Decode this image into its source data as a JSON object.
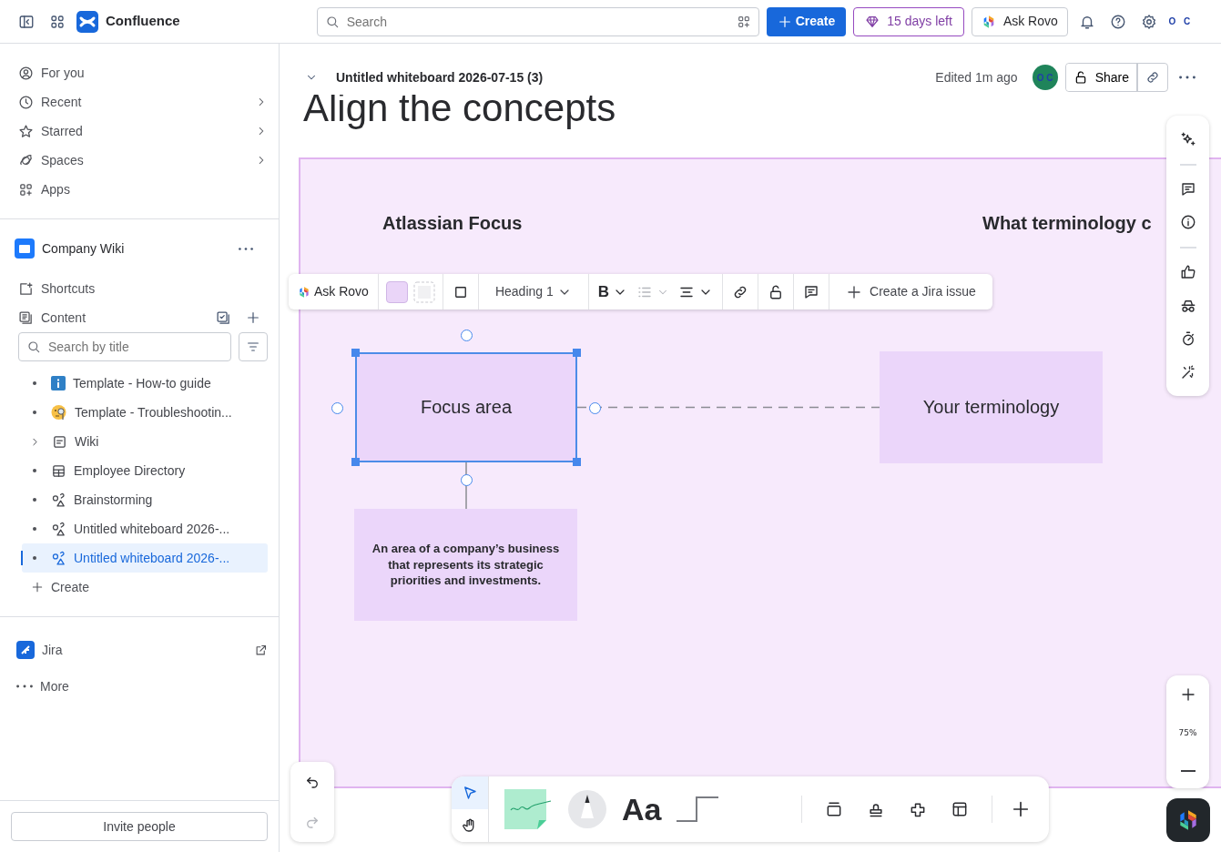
{
  "topbar": {
    "product": "Confluence",
    "search": {
      "placeholder": "Search"
    },
    "create": "Create",
    "trial": "15 days left",
    "ask_rovo": "Ask Rovo",
    "avatar": "O C"
  },
  "sidebar": {
    "nav": [
      {
        "label": "For you",
        "kind": "person",
        "chevron": false
      },
      {
        "label": "Recent",
        "kind": "clock",
        "chevron": true
      },
      {
        "label": "Starred",
        "kind": "star",
        "chevron": true
      },
      {
        "label": "Spaces",
        "kind": "planet",
        "chevron": true
      },
      {
        "label": "Apps",
        "kind": "apps",
        "chevron": false
      }
    ],
    "space": {
      "name": "Company Wiki"
    },
    "shortcuts": "Shortcuts",
    "content": "Content",
    "tree_search": {
      "placeholder": "Search by title"
    },
    "tree": [
      {
        "label": "Template - How-to guide",
        "kind": "info",
        "expandable": false,
        "selected": false
      },
      {
        "label": "Template - Troubleshootin...",
        "kind": "emoji",
        "expandable": false,
        "selected": false
      },
      {
        "label": "Wiki",
        "kind": "page",
        "expandable": true,
        "selected": false
      },
      {
        "label": "Employee Directory",
        "kind": "database",
        "expandable": false,
        "selected": false
      },
      {
        "label": "Brainstorming",
        "kind": "whiteboard",
        "expandable": false,
        "selected": false
      },
      {
        "label": "Untitled whiteboard 2026-...",
        "kind": "whiteboard",
        "expandable": false,
        "selected": false
      },
      {
        "label": "Untitled whiteboard 2026-...",
        "kind": "whiteboard",
        "expandable": false,
        "selected": true
      }
    ],
    "create": "Create",
    "jira": "Jira",
    "more": "More",
    "invite": "Invite people"
  },
  "page": {
    "title": "Untitled whiteboard 2026-07-15 (3)",
    "edited": "Edited 1m ago",
    "avatar": "O C",
    "share": "Share"
  },
  "board": {
    "heading": "Align the concepts",
    "columns": [
      "Atlassian Focus",
      "What terminology c"
    ],
    "toolbar": {
      "ask_rovo": "Ask Rovo",
      "text_style": "Heading 1",
      "bold": "B",
      "list_disabled": true,
      "jira": "Create a Jira issue"
    },
    "shapes": [
      {
        "kind": "sticky",
        "text": "Focus area",
        "selected": true
      },
      {
        "kind": "sticky",
        "text": "Your terminology",
        "selected": false
      },
      {
        "kind": "note",
        "text": "An area of a company’s business that represents its strategic priorities and investments.",
        "selected": false
      }
    ],
    "zoom": "75%",
    "tools": [
      {
        "kind": "select",
        "selected": true
      },
      {
        "kind": "hand",
        "selected": false
      }
    ],
    "text_tool": "Aa"
  }
}
